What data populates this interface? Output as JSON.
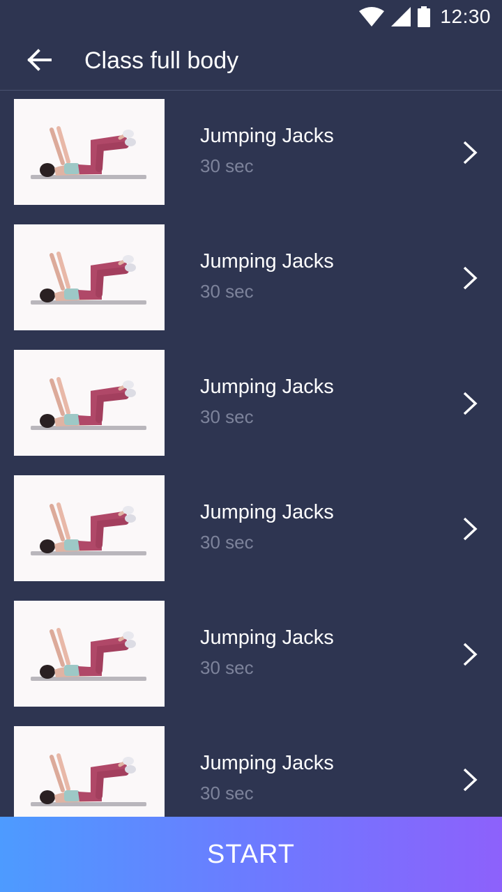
{
  "status_bar": {
    "time": "12:30",
    "icons": [
      "wifi-icon",
      "cellular-signal-icon",
      "battery-icon"
    ]
  },
  "app_bar": {
    "title": "Class full body",
    "back_icon": "arrow-left-icon"
  },
  "exercises": [
    {
      "name": "Jumping Jacks",
      "duration": "30 sec"
    },
    {
      "name": "Jumping Jacks",
      "duration": "30 sec"
    },
    {
      "name": "Jumping Jacks",
      "duration": "30 sec"
    },
    {
      "name": "Jumping Jacks",
      "duration": "30 sec"
    },
    {
      "name": "Jumping Jacks",
      "duration": "30 sec"
    },
    {
      "name": "Jumping Jacks",
      "duration": "30 sec"
    }
  ],
  "start_button": {
    "label": "START"
  },
  "colors": {
    "background": "#2e3551",
    "divider": "#4a5270",
    "secondary_text": "#7d839b",
    "gradient_start": "#4d9bff",
    "gradient_end": "#8d61fb"
  }
}
